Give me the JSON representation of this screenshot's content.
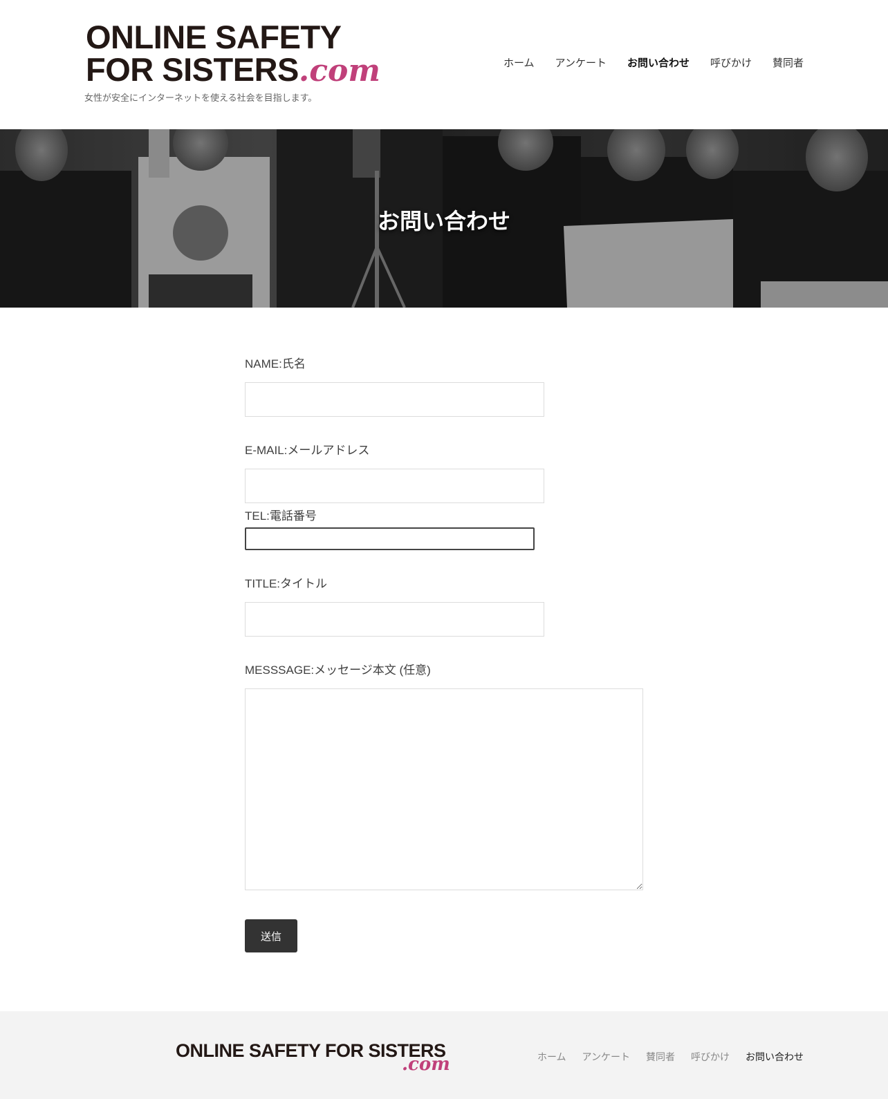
{
  "header": {
    "logo_line1": "ONLINE SAFETY",
    "logo_line2": "FOR SISTERS",
    "logo_com": ".com",
    "tagline": "女性が安全にインターネットを使える社会を目指します。",
    "nav": [
      {
        "label": "ホーム",
        "active": false
      },
      {
        "label": "アンケート",
        "active": false
      },
      {
        "label": "お問い合わせ",
        "active": true
      },
      {
        "label": "呼びかけ",
        "active": false
      },
      {
        "label": "賛同者",
        "active": false
      }
    ]
  },
  "hero": {
    "title": "お問い合わせ"
  },
  "form": {
    "name_label": "NAME:氏名",
    "name_value": "",
    "email_label": "E-MAIL:メールアドレス",
    "email_value": "",
    "tel_label": "TEL:電話番号",
    "tel_value": "",
    "title_label": "TITLE:タイトル",
    "title_value": "",
    "message_label": "MESSSAGE:メッセージ本文 (任意)",
    "message_value": "",
    "submit_label": "送信"
  },
  "footer": {
    "logo_text": "ONLINE SAFETY FOR SISTERS",
    "logo_com": ".com",
    "nav": [
      {
        "label": "ホーム",
        "active": false
      },
      {
        "label": "アンケート",
        "active": false
      },
      {
        "label": "賛同者",
        "active": false
      },
      {
        "label": "呼びかけ",
        "active": false
      },
      {
        "label": "お問い合わせ",
        "active": true
      }
    ]
  },
  "colors": {
    "brand_dark": "#231815",
    "brand_gradient_start": "#b23a7a",
    "brand_gradient_end": "#d6456e",
    "button_bg": "#333333",
    "footer_bg": "#f3f3f3"
  }
}
